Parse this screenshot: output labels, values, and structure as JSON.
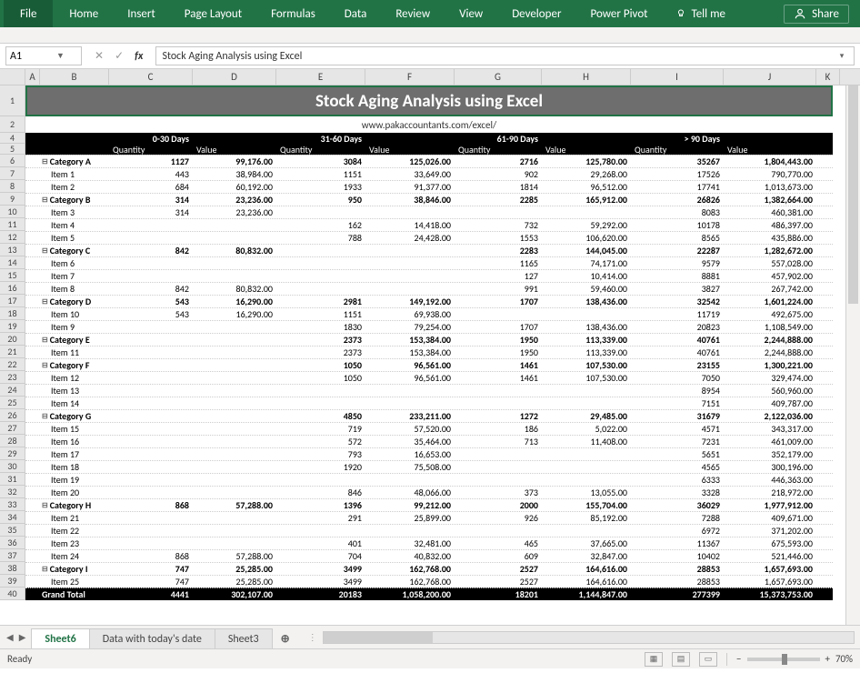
{
  "ribbon": {
    "file": "File",
    "tabs": [
      "Home",
      "Insert",
      "Page Layout",
      "Formulas",
      "Data",
      "Review",
      "View",
      "Developer",
      "Power Pivot"
    ],
    "tellme": "Tell me",
    "share": "Share"
  },
  "formula_bar": {
    "name_box": "A1",
    "formula": "Stock Aging Analysis using Excel"
  },
  "columns": [
    "A",
    "B",
    "C",
    "D",
    "E",
    "F",
    "G",
    "H",
    "I",
    "J",
    "K"
  ],
  "row_numbers": [
    "1",
    "2",
    "4",
    "5",
    "6",
    "7",
    "8",
    "9",
    "10",
    "11",
    "12",
    "13",
    "14",
    "15",
    "16",
    "17",
    "18",
    "19",
    "20",
    "21",
    "22",
    "23",
    "24",
    "25",
    "26",
    "27",
    "28",
    "29",
    "30",
    "31",
    "32",
    "33",
    "34",
    "35",
    "36",
    "37",
    "38",
    "39",
    "40"
  ],
  "title": "Stock Aging Analysis using Excel",
  "subtitle": "www.pakaccountants.com/excel/",
  "pivot": {
    "buckets": [
      "0-30 Days",
      "31-60 Days",
      "61-90 Days",
      "> 90 Days"
    ],
    "measures": [
      "Quantity",
      "Value"
    ],
    "rows": [
      {
        "t": "cat",
        "label": "Category A",
        "v": [
          "1127",
          "99,176.00",
          "3084",
          "125,026.00",
          "2716",
          "125,780.00",
          "35267",
          "1,804,443.00"
        ]
      },
      {
        "t": "itm",
        "label": "Item 1",
        "v": [
          "443",
          "38,984.00",
          "1151",
          "33,649.00",
          "902",
          "29,268.00",
          "17526",
          "790,770.00"
        ]
      },
      {
        "t": "itm",
        "label": "Item 2",
        "v": [
          "684",
          "60,192.00",
          "1933",
          "91,377.00",
          "1814",
          "96,512.00",
          "17741",
          "1,013,673.00"
        ]
      },
      {
        "t": "cat",
        "label": "Category B",
        "v": [
          "314",
          "23,236.00",
          "950",
          "38,846.00",
          "2285",
          "165,912.00",
          "26826",
          "1,382,664.00"
        ]
      },
      {
        "t": "itm",
        "label": "Item 3",
        "v": [
          "314",
          "23,236.00",
          "",
          "",
          "",
          "",
          "8083",
          "460,381.00"
        ]
      },
      {
        "t": "itm",
        "label": "Item 4",
        "v": [
          "",
          "",
          "162",
          "14,418.00",
          "732",
          "59,292.00",
          "10178",
          "486,397.00"
        ]
      },
      {
        "t": "itm",
        "label": "Item 5",
        "v": [
          "",
          "",
          "788",
          "24,428.00",
          "1553",
          "106,620.00",
          "8565",
          "435,886.00"
        ]
      },
      {
        "t": "cat",
        "label": "Category C",
        "v": [
          "842",
          "80,832.00",
          "",
          "",
          "2283",
          "144,045.00",
          "22287",
          "1,282,672.00"
        ]
      },
      {
        "t": "itm",
        "label": "Item 6",
        "v": [
          "",
          "",
          "",
          "",
          "1165",
          "74,171.00",
          "9579",
          "557,028.00"
        ]
      },
      {
        "t": "itm",
        "label": "Item 7",
        "v": [
          "",
          "",
          "",
          "",
          "127",
          "10,414.00",
          "8881",
          "457,902.00"
        ]
      },
      {
        "t": "itm",
        "label": "Item 8",
        "v": [
          "842",
          "80,832.00",
          "",
          "",
          "991",
          "59,460.00",
          "3827",
          "267,742.00"
        ]
      },
      {
        "t": "cat",
        "label": "Category D",
        "v": [
          "543",
          "16,290.00",
          "2981",
          "149,192.00",
          "1707",
          "138,436.00",
          "32542",
          "1,601,224.00"
        ]
      },
      {
        "t": "itm",
        "label": "Item 10",
        "v": [
          "543",
          "16,290.00",
          "1151",
          "69,938.00",
          "",
          "",
          "11719",
          "492,675.00"
        ]
      },
      {
        "t": "itm",
        "label": "Item 9",
        "v": [
          "",
          "",
          "1830",
          "79,254.00",
          "1707",
          "138,436.00",
          "20823",
          "1,108,549.00"
        ]
      },
      {
        "t": "cat",
        "label": "Category E",
        "v": [
          "",
          "",
          "2373",
          "153,384.00",
          "1950",
          "113,339.00",
          "40761",
          "2,244,888.00"
        ]
      },
      {
        "t": "itm",
        "label": "Item 11",
        "v": [
          "",
          "",
          "2373",
          "153,384.00",
          "1950",
          "113,339.00",
          "40761",
          "2,244,888.00"
        ]
      },
      {
        "t": "cat",
        "label": "Category F",
        "v": [
          "",
          "",
          "1050",
          "96,561.00",
          "1461",
          "107,530.00",
          "23155",
          "1,300,221.00"
        ]
      },
      {
        "t": "itm",
        "label": "Item 12",
        "v": [
          "",
          "",
          "1050",
          "96,561.00",
          "1461",
          "107,530.00",
          "7050",
          "329,474.00"
        ]
      },
      {
        "t": "itm",
        "label": "Item 13",
        "v": [
          "",
          "",
          "",
          "",
          "",
          "",
          "8954",
          "560,960.00"
        ]
      },
      {
        "t": "itm",
        "label": "Item 14",
        "v": [
          "",
          "",
          "",
          "",
          "",
          "",
          "7151",
          "409,787.00"
        ]
      },
      {
        "t": "cat",
        "label": "Category G",
        "v": [
          "",
          "",
          "4850",
          "233,211.00",
          "1272",
          "29,485.00",
          "31679",
          "2,122,036.00"
        ]
      },
      {
        "t": "itm",
        "label": "Item 15",
        "v": [
          "",
          "",
          "719",
          "57,520.00",
          "186",
          "5,022.00",
          "4571",
          "343,317.00"
        ]
      },
      {
        "t": "itm",
        "label": "Item 16",
        "v": [
          "",
          "",
          "572",
          "35,464.00",
          "713",
          "11,408.00",
          "7231",
          "461,009.00"
        ]
      },
      {
        "t": "itm",
        "label": "Item 17",
        "v": [
          "",
          "",
          "793",
          "16,653.00",
          "",
          "",
          "5651",
          "352,179.00"
        ]
      },
      {
        "t": "itm",
        "label": "Item 18",
        "v": [
          "",
          "",
          "1920",
          "75,508.00",
          "",
          "",
          "4565",
          "300,196.00"
        ]
      },
      {
        "t": "itm",
        "label": "Item 19",
        "v": [
          "",
          "",
          "",
          "",
          "",
          "",
          "6333",
          "446,363.00"
        ]
      },
      {
        "t": "itm",
        "label": "Item 20",
        "v": [
          "",
          "",
          "846",
          "48,066.00",
          "373",
          "13,055.00",
          "3328",
          "218,972.00"
        ]
      },
      {
        "t": "cat",
        "label": "Category H",
        "v": [
          "868",
          "57,288.00",
          "1396",
          "99,212.00",
          "2000",
          "155,704.00",
          "36029",
          "1,977,912.00"
        ]
      },
      {
        "t": "itm",
        "label": "Item 21",
        "v": [
          "",
          "",
          "291",
          "25,899.00",
          "926",
          "85,192.00",
          "7288",
          "409,671.00"
        ]
      },
      {
        "t": "itm",
        "label": "Item 22",
        "v": [
          "",
          "",
          "",
          "",
          "",
          "",
          "6972",
          "371,202.00"
        ]
      },
      {
        "t": "itm",
        "label": "Item 23",
        "v": [
          "",
          "",
          "401",
          "32,481.00",
          "465",
          "37,665.00",
          "11367",
          "675,593.00"
        ]
      },
      {
        "t": "itm",
        "label": "Item 24",
        "v": [
          "868",
          "57,288.00",
          "704",
          "40,832.00",
          "609",
          "32,847.00",
          "10402",
          "521,446.00"
        ]
      },
      {
        "t": "cat",
        "label": "Category I",
        "v": [
          "747",
          "25,285.00",
          "3499",
          "162,768.00",
          "2527",
          "164,616.00",
          "28853",
          "1,657,693.00"
        ]
      },
      {
        "t": "itm",
        "label": "Item 25",
        "v": [
          "747",
          "25,285.00",
          "3499",
          "162,768.00",
          "2527",
          "164,616.00",
          "28853",
          "1,657,693.00"
        ]
      },
      {
        "t": "gt",
        "label": "Grand Total",
        "v": [
          "4441",
          "302,107.00",
          "20183",
          "1,058,200.00",
          "18201",
          "1,144,847.00",
          "277399",
          "15,373,753.00"
        ]
      }
    ]
  },
  "sheets": {
    "active": "Sheet6",
    "tabs": [
      "Sheet6",
      "Data with today's date",
      "Sheet3"
    ],
    "add": "⊕"
  },
  "status": {
    "ready": "Ready",
    "zoom": "70%",
    "minus": "−",
    "plus": "+"
  }
}
